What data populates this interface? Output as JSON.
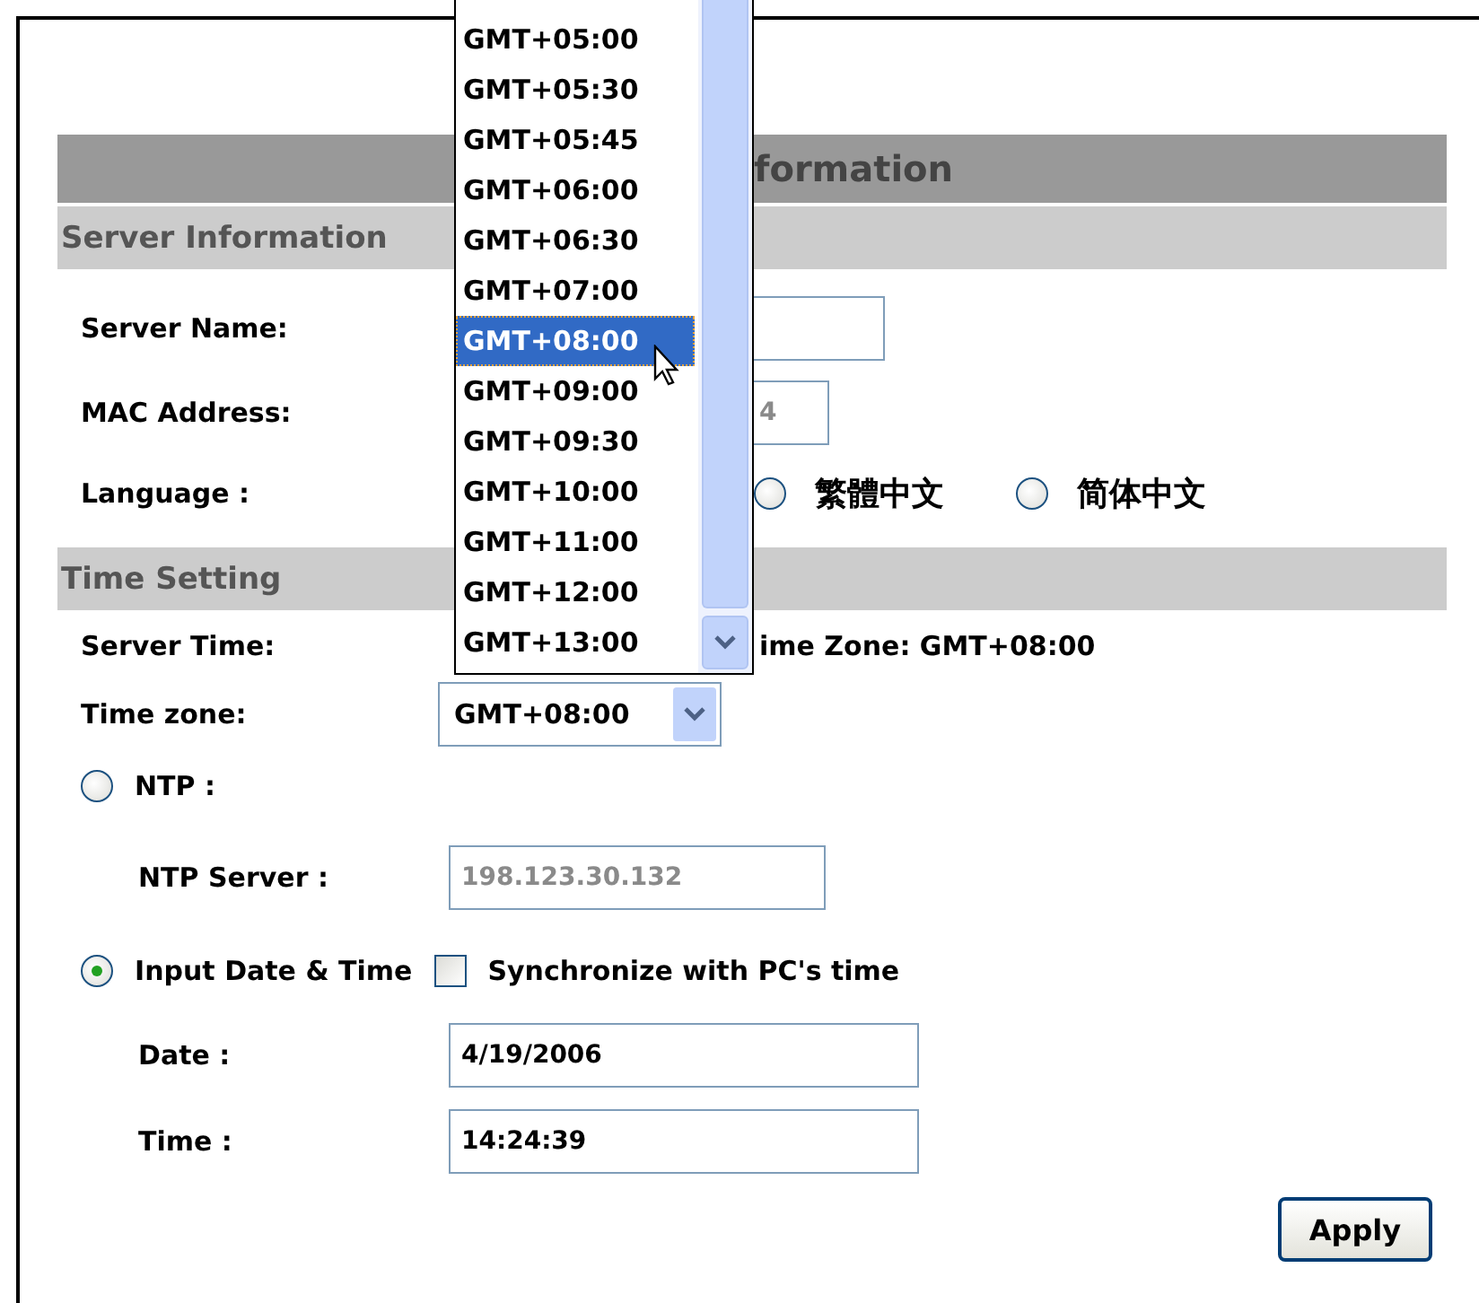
{
  "header": {
    "title": "formation"
  },
  "server_information": {
    "title": "Server Information",
    "server_name": {
      "label": "Server Name:"
    },
    "mac_address": {
      "label": "MAC Address:",
      "value": "4",
      "disabled": true
    },
    "language": {
      "label": "Language :",
      "options": [
        {
          "label": "繁體中文",
          "selected": false
        },
        {
          "label": "简体中文",
          "selected": false
        }
      ]
    }
  },
  "time_setting": {
    "title": "Time Setting",
    "server_time": {
      "label": "Server Time:",
      "value": "ime Zone: GMT+08:00"
    },
    "time_zone": {
      "label": "Time zone:",
      "value": "GMT+08:00"
    },
    "ntp": {
      "label": "NTP :",
      "selected": false
    },
    "ntp_server": {
      "label": "NTP Server :",
      "value": "198.123.30.132",
      "disabled": true
    },
    "manual": {
      "label": "Input Date & Time",
      "selected": true
    },
    "sync": {
      "label": "Synchronize with PC's time",
      "checked": false
    },
    "date": {
      "label": "Date :",
      "value": "4/19/2006"
    },
    "time": {
      "label": "Time :",
      "value": "14:24:39"
    }
  },
  "apply_button": "Apply",
  "dropdown": {
    "options": [
      {
        "label": "GMT+05:00",
        "selected": false
      },
      {
        "label": "GMT+05:30",
        "selected": false
      },
      {
        "label": "GMT+05:45",
        "selected": false
      },
      {
        "label": "GMT+06:00",
        "selected": false
      },
      {
        "label": "GMT+06:30",
        "selected": false
      },
      {
        "label": "GMT+07:00",
        "selected": false
      },
      {
        "label": "GMT+08:00",
        "selected": true
      },
      {
        "label": "GMT+09:00",
        "selected": false
      },
      {
        "label": "GMT+09:30",
        "selected": false
      },
      {
        "label": "GMT+10:00",
        "selected": false
      },
      {
        "label": "GMT+11:00",
        "selected": false
      },
      {
        "label": "GMT+12:00",
        "selected": false
      },
      {
        "label": "GMT+13:00",
        "selected": false
      }
    ]
  }
}
